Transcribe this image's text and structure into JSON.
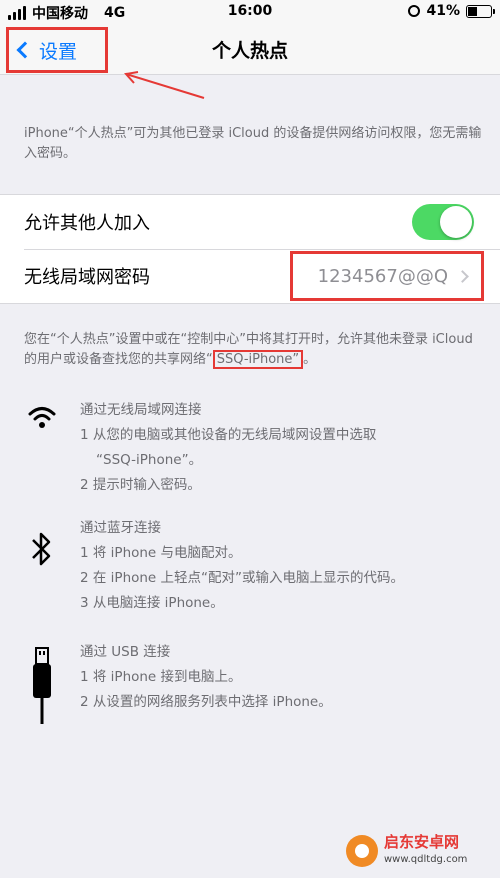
{
  "status": {
    "carrier": "中国移动",
    "network": "4G",
    "time": "16:00",
    "battery": "41%"
  },
  "nav": {
    "back_label": "设置",
    "title": "个人热点"
  },
  "intro": "iPhone“个人热点”可为其他已登录 iCloud 的设备提供网络访问权限，您无需输入密码。",
  "settings": {
    "allow_label": "允许其他人加入",
    "allow_on": true,
    "password_label": "无线局域网密码",
    "password_value": "1234567@@Q"
  },
  "note": {
    "before": "您在“个人热点”设置中或在“控制中心”中将其打开时，允许其他未登录 iCloud 的用户或设备查找您的共享网络“",
    "network_name": "SSQ-iPhone”",
    "after": "。"
  },
  "methods": {
    "wifi": {
      "icon": "wifi-icon",
      "title": "通过无线局域网连接",
      "steps": [
        "1 从您的电脑或其他设备的无线局域网设置中选取",
        "“SSQ-iPhone”。",
        "2 提示时输入密码。"
      ]
    },
    "bluetooth": {
      "icon": "bluetooth-icon",
      "title": "通过蓝牙连接",
      "steps": [
        "1 将 iPhone 与电脑配对。",
        "2 在 iPhone 上轻点“配对”或输入电脑上显示的代码。",
        "3 从电脑连接 iPhone。"
      ]
    },
    "usb": {
      "icon": "usb-cable-icon",
      "title": "通过 USB 连接",
      "steps": [
        "1 将 iPhone 接到电脑上。",
        "2 从设置的网络服务列表中选择 iPhone。"
      ]
    }
  },
  "watermark": {
    "name": "启东安卓网",
    "url": "www.qdltdg.com"
  },
  "colors": {
    "accent": "#0a7aff",
    "toggle_on": "#4cd964",
    "annotation": "#e53935"
  }
}
